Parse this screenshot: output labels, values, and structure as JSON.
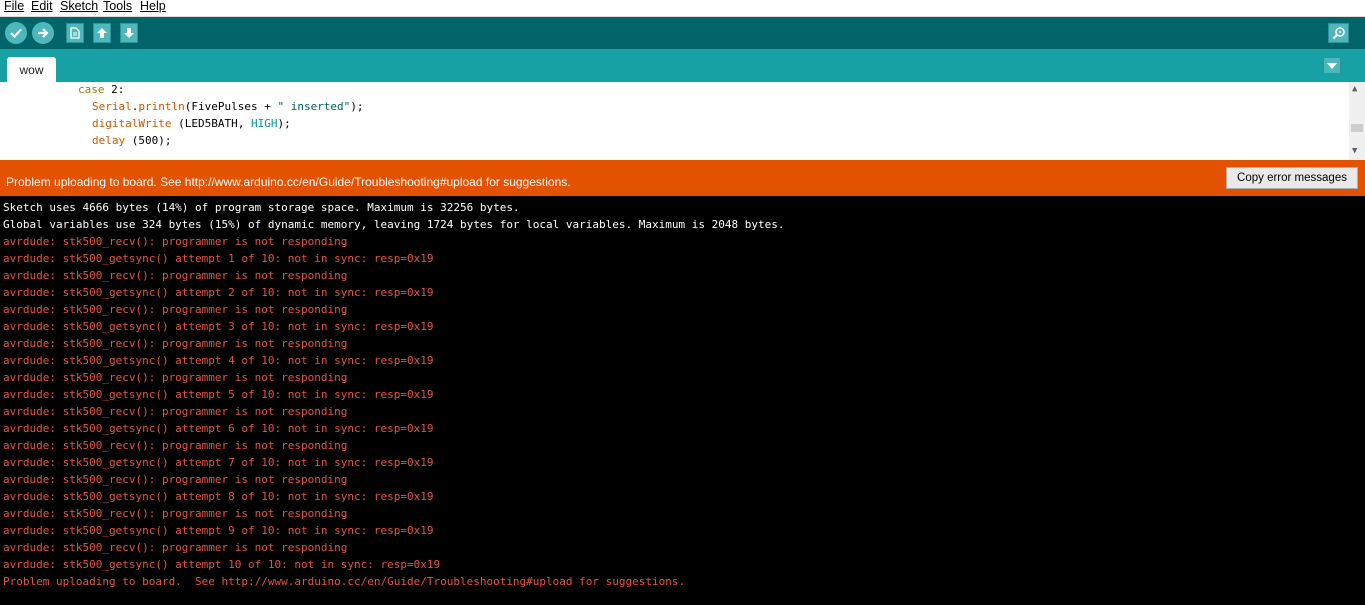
{
  "menu": [
    {
      "label": "File"
    },
    {
      "label": "Edit"
    },
    {
      "label": "Sketch"
    },
    {
      "label": "Tools"
    },
    {
      "label": "Help"
    }
  ],
  "toolbar": {
    "verify": "verify",
    "upload": "upload",
    "new": "new",
    "open": "open",
    "save": "save",
    "serial_monitor": "serial-monitor"
  },
  "tabs": [
    {
      "label": "wow"
    }
  ],
  "code": {
    "line1": {
      "keyword": "case",
      "rest": " 2:"
    },
    "line2": {
      "obj": "Serial",
      "dot": ".",
      "fn": "println",
      "args_open": "(FivePulses + ",
      "str": "\" inserted\"",
      "close": ");"
    },
    "line3": {
      "fn": "digitalWrite",
      "open": " (LED5BATH, ",
      "const": "HIGH",
      "close": ");"
    },
    "line4": {
      "fn": "delay",
      "rest": " (500);"
    }
  },
  "status": {
    "message": "Problem uploading to board.  See http://www.arduino.cc/en/Guide/Troubleshooting#upload for suggestions.",
    "copy_button": "Copy error messages",
    "color": "#e35200"
  },
  "console": [
    {
      "text": "Sketch uses 4666 bytes (14%) of program storage space. Maximum is 32256 bytes.",
      "type": "info"
    },
    {
      "text": "Global variables use 324 bytes (15%) of dynamic memory, leaving 1724 bytes for local variables. Maximum is 2048 bytes.",
      "type": "info"
    },
    {
      "text": "avrdude: stk500_recv(): programmer is not responding",
      "type": "error"
    },
    {
      "text": "avrdude: stk500_getsync() attempt 1 of 10: not in sync: resp=0x19",
      "type": "error"
    },
    {
      "text": "avrdude: stk500_recv(): programmer is not responding",
      "type": "error"
    },
    {
      "text": "avrdude: stk500_getsync() attempt 2 of 10: not in sync: resp=0x19",
      "type": "error"
    },
    {
      "text": "avrdude: stk500_recv(): programmer is not responding",
      "type": "error"
    },
    {
      "text": "avrdude: stk500_getsync() attempt 3 of 10: not in sync: resp=0x19",
      "type": "error"
    },
    {
      "text": "avrdude: stk500_recv(): programmer is not responding",
      "type": "error"
    },
    {
      "text": "avrdude: stk500_getsync() attempt 4 of 10: not in sync: resp=0x19",
      "type": "error"
    },
    {
      "text": "avrdude: stk500_recv(): programmer is not responding",
      "type": "error"
    },
    {
      "text": "avrdude: stk500_getsync() attempt 5 of 10: not in sync: resp=0x19",
      "type": "error"
    },
    {
      "text": "avrdude: stk500_recv(): programmer is not responding",
      "type": "error"
    },
    {
      "text": "avrdude: stk500_getsync() attempt 6 of 10: not in sync: resp=0x19",
      "type": "error"
    },
    {
      "text": "avrdude: stk500_recv(): programmer is not responding",
      "type": "error"
    },
    {
      "text": "avrdude: stk500_getsync() attempt 7 of 10: not in sync: resp=0x19",
      "type": "error"
    },
    {
      "text": "avrdude: stk500_recv(): programmer is not responding",
      "type": "error"
    },
    {
      "text": "avrdude: stk500_getsync() attempt 8 of 10: not in sync: resp=0x19",
      "type": "error"
    },
    {
      "text": "avrdude: stk500_recv(): programmer is not responding",
      "type": "error"
    },
    {
      "text": "avrdude: stk500_getsync() attempt 9 of 10: not in sync: resp=0x19",
      "type": "error"
    },
    {
      "text": "avrdude: stk500_recv(): programmer is not responding",
      "type": "error"
    },
    {
      "text": "avrdude: stk500_getsync() attempt 10 of 10: not in sync: resp=0x19",
      "type": "error"
    },
    {
      "text": "Problem uploading to board.  See http://www.arduino.cc/en/Guide/Troubleshooting#upload for suggestions.",
      "type": "error"
    }
  ],
  "colors": {
    "toolbar": "#006468",
    "tabbar": "#17a1a5",
    "button": "#4db7bb",
    "error_text": "#e5553f"
  }
}
